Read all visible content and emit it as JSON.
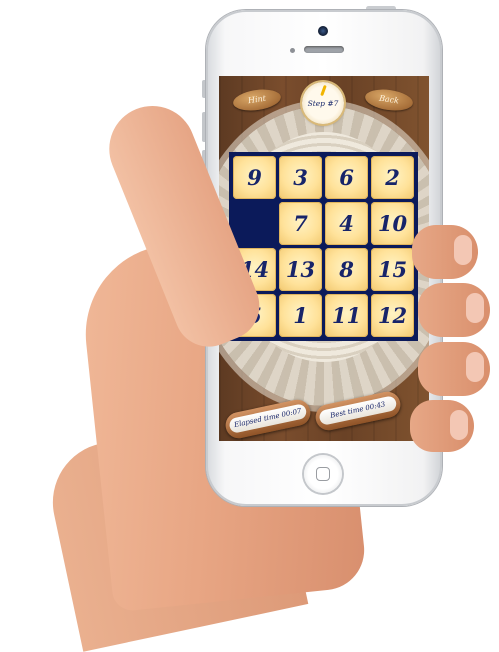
{
  "header": {
    "hint_label": "Hint",
    "step_label": "Step #7",
    "back_label": "Back"
  },
  "board": {
    "rows": 4,
    "cols": 4,
    "tiles": [
      "9",
      "3",
      "6",
      "2",
      "",
      "7",
      "4",
      "10",
      "14",
      "13",
      "8",
      "15",
      "5",
      "1",
      "11",
      "12"
    ]
  },
  "footer": {
    "elapsed_label": "Elapsed time 00:07",
    "best_label": "Best time 00:43"
  },
  "colors": {
    "board_background": "#0b1a5a",
    "tile_face": "#ffe29a",
    "tile_text": "#17246a",
    "wood": "#6a4226"
  },
  "icons": {
    "step_indicator": "clock-hand-icon"
  }
}
